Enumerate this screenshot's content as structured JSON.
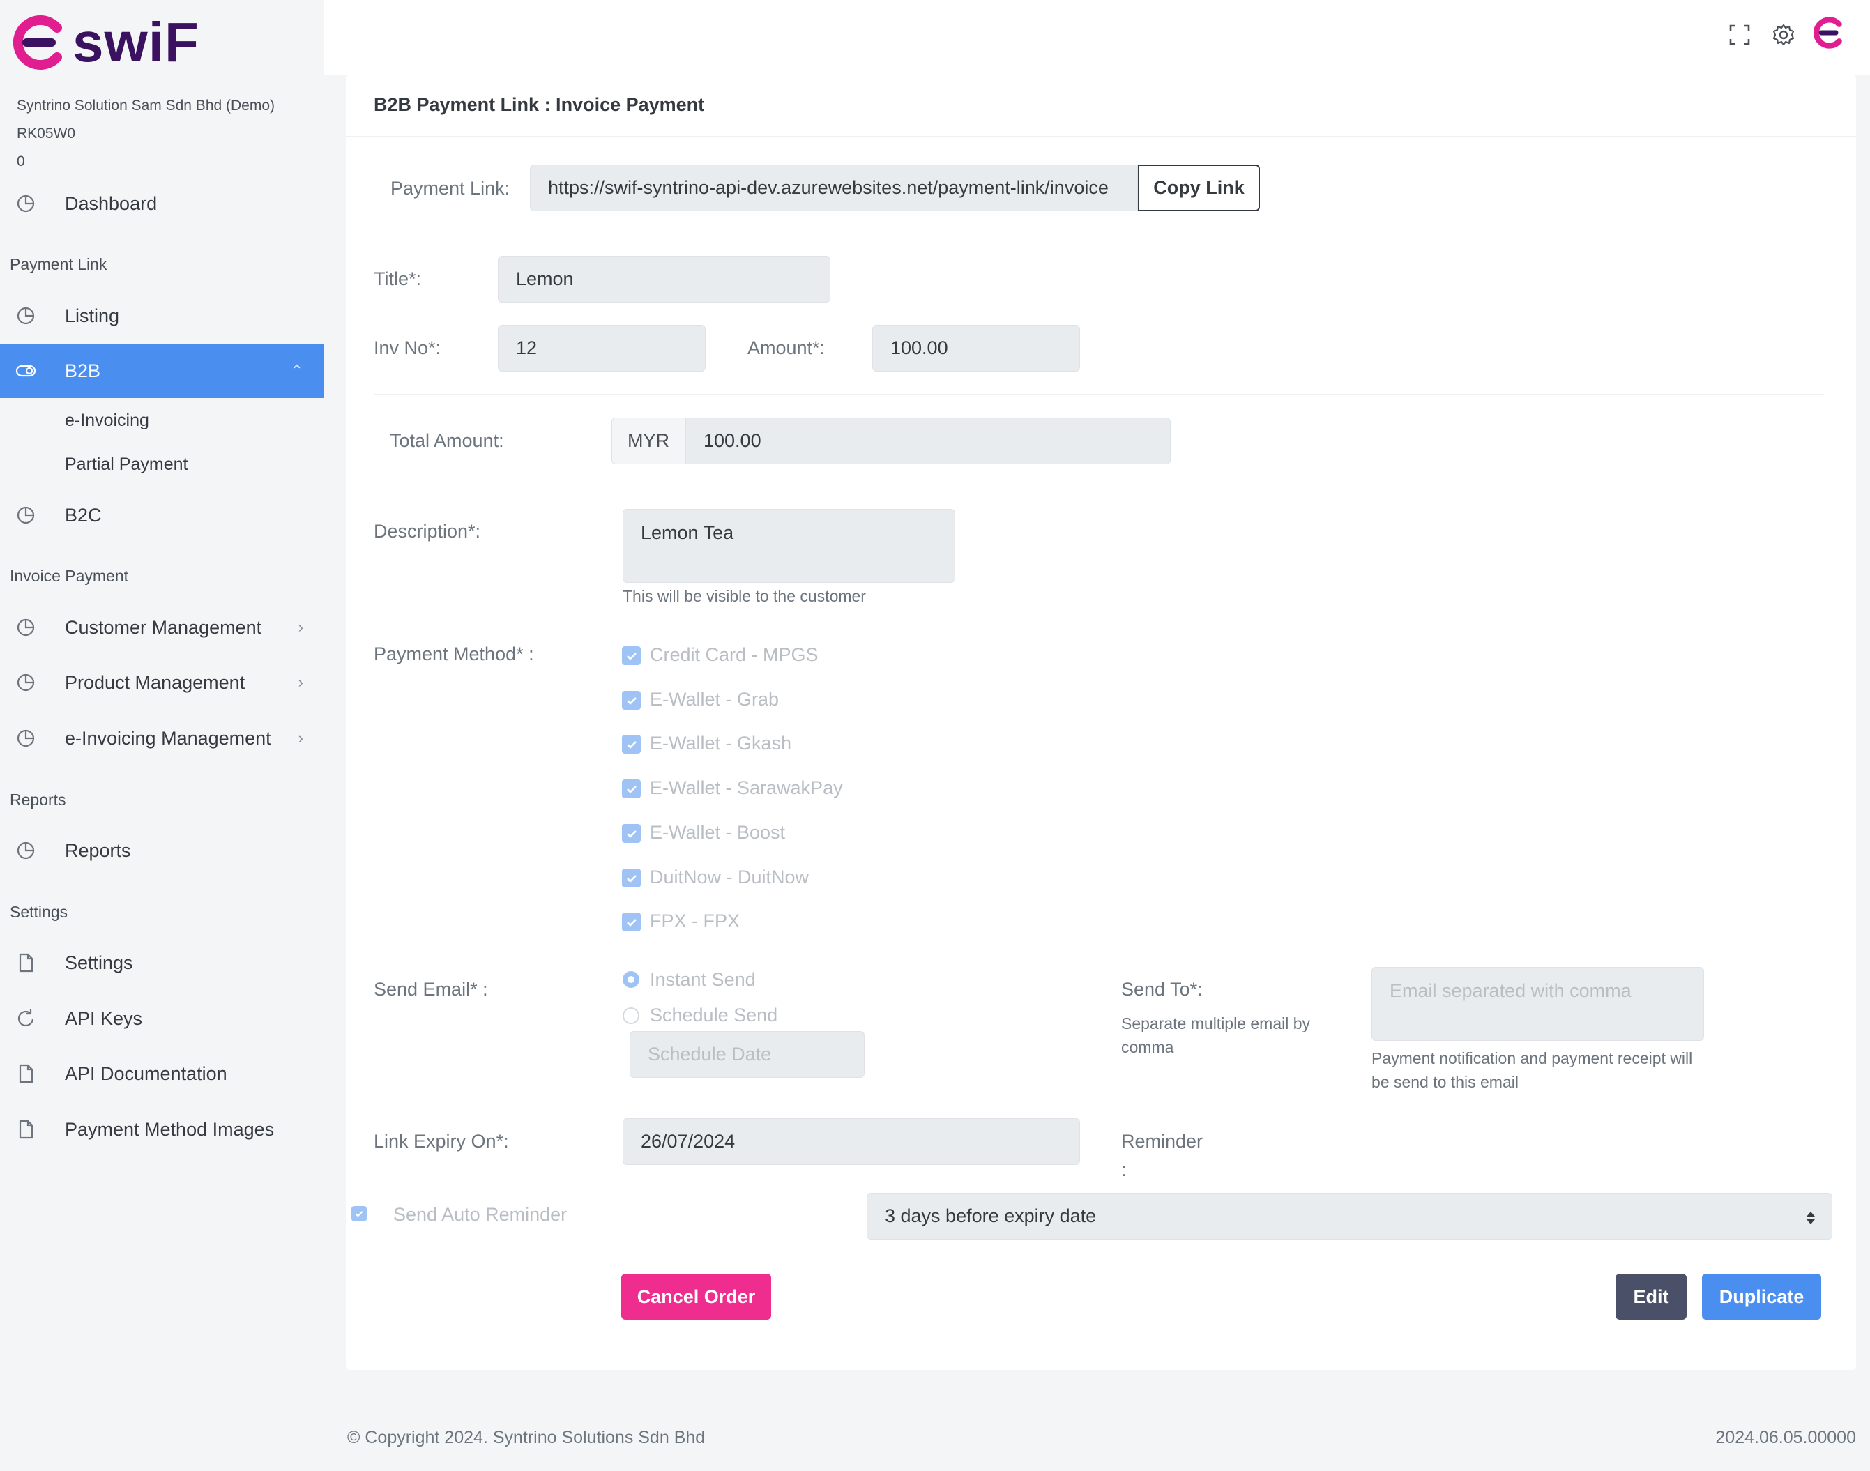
{
  "brand": {
    "name": "swiF",
    "primary": "#3a1260",
    "accent": "#e01e8f",
    "active": "#4a8ef0"
  },
  "company": {
    "name": "Syntrino Solution Sam Sdn Bhd (Demo)",
    "code": "RK05W0",
    "balance": "0"
  },
  "sidebar": {
    "dashboard": "Dashboard",
    "section_payment_link": "Payment Link",
    "listing": "Listing",
    "b2b": "B2B",
    "b2b_sub": [
      "e-Invoicing",
      "Partial Payment"
    ],
    "b2c": "B2C",
    "section_invoice_payment": "Invoice Payment",
    "customer_management": "Customer Management",
    "product_management": "Product Management",
    "einvoicing_management": "e-Invoicing Management",
    "section_reports": "Reports",
    "reports": "Reports",
    "section_settings": "Settings",
    "settings": "Settings",
    "api_keys": "API Keys",
    "api_documentation": "API Documentation",
    "payment_method_images": "Payment Method Images"
  },
  "topbar": {
    "icons": [
      "fullscreen-icon",
      "gear-icon",
      "user-avatar-logo"
    ]
  },
  "page": {
    "title": "B2B Payment Link : Invoice Payment",
    "payment_link_label": "Payment Link:",
    "payment_link_value": "https://swif-syntrino-api-dev.azurewebsites.net/payment-link/invoice",
    "copy_link": "Copy Link",
    "title_label": "Title*:",
    "title_value": "Lemon",
    "inv_no_label": "Inv No*:",
    "inv_no_value": "12",
    "amount_label": "Amount*:",
    "amount_value": "100.00",
    "total_amount_label": "Total Amount:",
    "currency": "MYR",
    "total_amount_value": "100.00",
    "description_label": "Description*:",
    "description_value": "Lemon Tea",
    "description_help": "This will be visible to the customer",
    "payment_method_label": "Payment Method* :",
    "payment_methods": [
      "Credit Card - MPGS",
      "E-Wallet - Grab",
      "E-Wallet - Gkash",
      "E-Wallet - SarawakPay",
      "E-Wallet - Boost",
      "DuitNow - DuitNow",
      "FPX - FPX"
    ],
    "send_email_label": "Send Email* :",
    "instant_send": "Instant Send",
    "schedule_send": "Schedule Send",
    "schedule_date_placeholder": "Schedule Date",
    "send_to_label": "Send To*:",
    "send_to_help": "Separate multiple email by comma",
    "send_to_placeholder": "Email separated with comma",
    "send_to_note": "Payment notification and payment receipt will be send to this email",
    "link_expiry_label": "Link Expiry On*:",
    "link_expiry_value": "26/07/2024",
    "reminder_label": "Reminder",
    "reminder_colon": ":",
    "send_auto_reminder": "Send Auto Reminder",
    "reminder_option": "3 days before expiry date",
    "cancel_order": "Cancel Order",
    "edit": "Edit",
    "duplicate": "Duplicate"
  },
  "footer": {
    "copyright": "© Copyright 2024. Syntrino Solutions Sdn Bhd",
    "version": "2024.06.05.00000"
  }
}
